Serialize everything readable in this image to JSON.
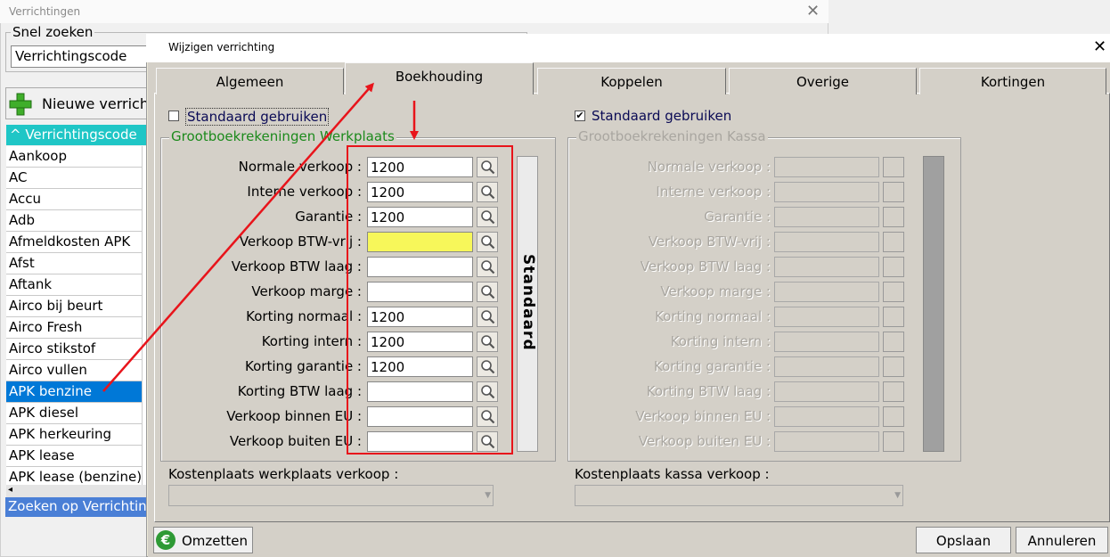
{
  "background_window": {
    "title": "Verrichtingen",
    "snel_zoeken": {
      "label": "Snel zoeken",
      "select_value": "Verrichtingscode"
    },
    "new_button_label": "Nieuwe verrichting",
    "list_header": "^ Verrichtingscode",
    "list_items": [
      "Aankoop",
      "AC",
      "Accu",
      "Adb",
      "Afmeldkosten APK",
      "Afst",
      "Aftank",
      "Airco bij beurt",
      "Airco Fresh",
      "Airco stikstof",
      "Airco vullen",
      "APK benzine",
      "APK diesel",
      "APK herkeuring",
      "APK lease",
      "APK lease (benzine)"
    ],
    "selected_item": "APK benzine",
    "status_text": "Zoeken op Verrichtingscode"
  },
  "dialog": {
    "title": "Wijzigen verrichting",
    "tabs": [
      "Algemeen",
      "Boekhouding",
      "Koppelen",
      "Overige",
      "Kortingen"
    ],
    "active_tab": "Boekhouding",
    "werkplaats": {
      "checkbox_label": "Standaard gebruiken",
      "checked": false,
      "group_title": "Grootboekrekeningen Werkplaats",
      "fields": [
        {
          "label": "Normale verkoop :",
          "value": "1200"
        },
        {
          "label": "Interne verkoop :",
          "value": "1200"
        },
        {
          "label": "Garantie :",
          "value": "1200"
        },
        {
          "label": "Verkoop BTW-vrij :",
          "value": ""
        },
        {
          "label": "Verkoop BTW laag :",
          "value": ""
        },
        {
          "label": "Verkoop marge :",
          "value": ""
        },
        {
          "label": "Korting normaal :",
          "value": "1200"
        },
        {
          "label": "Korting intern :",
          "value": "1200"
        },
        {
          "label": "Korting garantie :",
          "value": "1200"
        },
        {
          "label": "Korting BTW laag :",
          "value": ""
        },
        {
          "label": "Verkoop binnen EU :",
          "value": ""
        },
        {
          "label": "Verkoop buiten EU :",
          "value": ""
        }
      ],
      "standaard_button": "Standaard",
      "kostenplaats_label": "Kostenplaats werkplaats verkoop :"
    },
    "kassa": {
      "checkbox_label": "Standaard gebruiken",
      "checked": true,
      "group_title": "Grootboekrekeningen Kassa",
      "fields": [
        {
          "label": "Normale verkoop :"
        },
        {
          "label": "Interne verkoop :"
        },
        {
          "label": "Garantie :"
        },
        {
          "label": "Verkoop BTW-vrij :"
        },
        {
          "label": "Verkoop BTW laag :"
        },
        {
          "label": "Verkoop marge :"
        },
        {
          "label": "Korting normaal :"
        },
        {
          "label": "Korting intern :"
        },
        {
          "label": "Korting garantie :"
        },
        {
          "label": "Korting BTW laag :"
        },
        {
          "label": "Verkoop binnen EU :"
        },
        {
          "label": "Verkoop buiten EU :"
        }
      ],
      "kostenplaats_label": "Kostenplaats kassa verkoop :"
    },
    "omzetten_label": "Omzetten",
    "opslaan_label": "Opslaan",
    "annuleren_label": "Annuleren"
  },
  "colors": {
    "highlight_field": "#f7f75a",
    "annotation": "#e8141b",
    "selection": "#0078d7",
    "list_header": "#1fc6c6"
  }
}
